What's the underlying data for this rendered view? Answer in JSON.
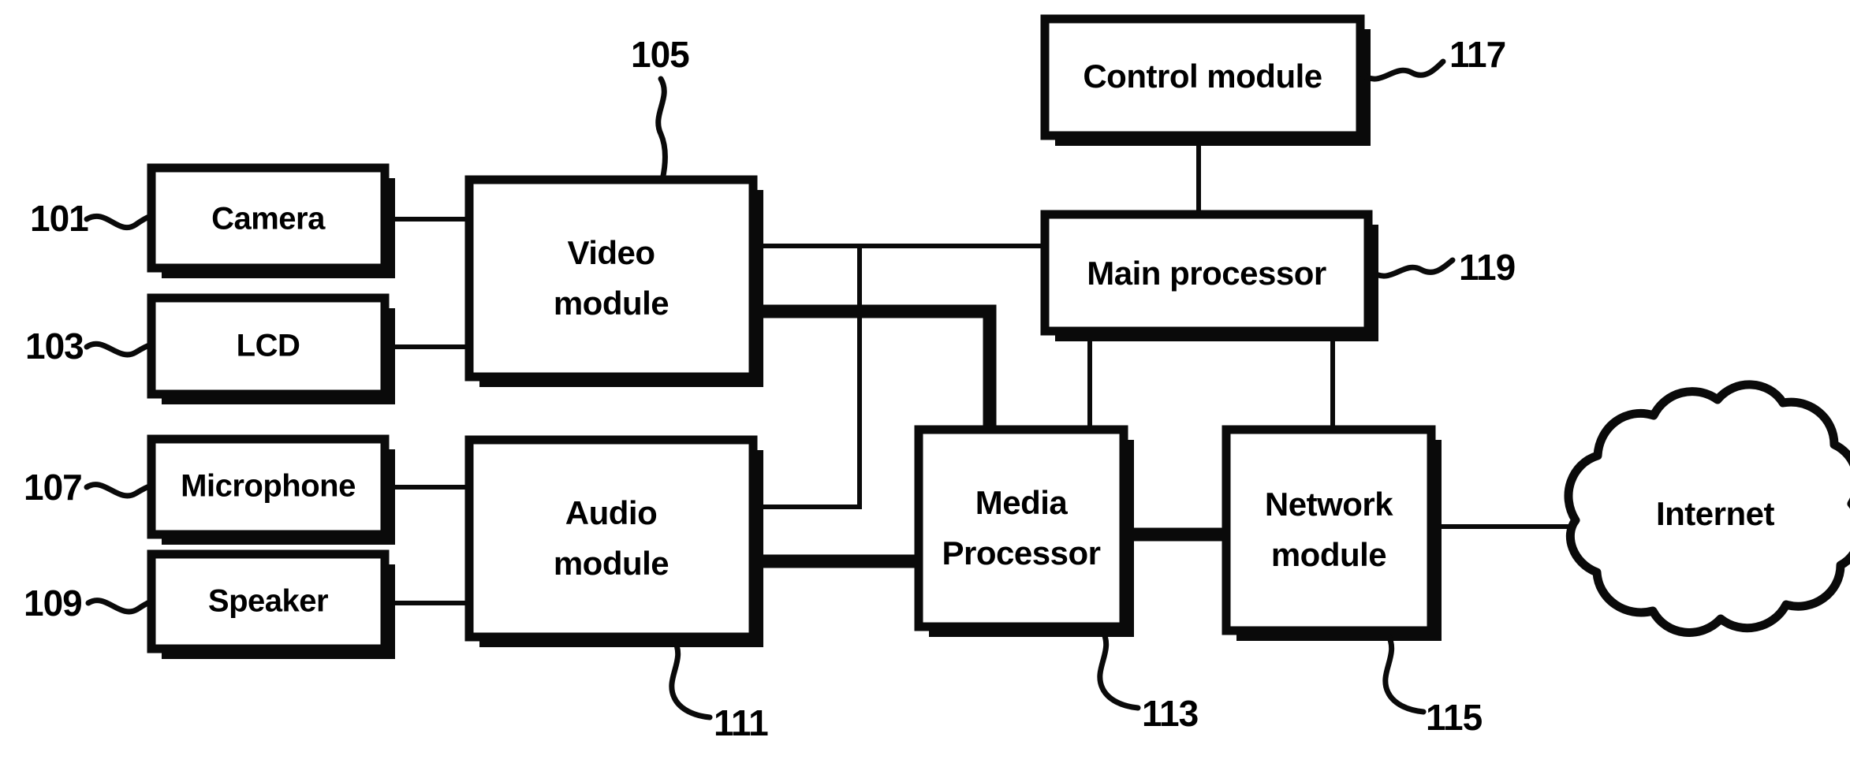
{
  "figure": {
    "type": "block-diagram",
    "style": "patent-drawing",
    "background_color": "#ffffff",
    "line_color": "#000000"
  },
  "blocks": [
    {
      "id": "camera",
      "label": "Camera",
      "ref": "101",
      "lines": [
        "Camera"
      ]
    },
    {
      "id": "lcd",
      "label": "LCD",
      "ref": "103",
      "lines": [
        "LCD"
      ]
    },
    {
      "id": "video_module",
      "label": "Video module",
      "ref": "105",
      "lines": [
        "Video",
        "module"
      ]
    },
    {
      "id": "microphone",
      "label": "Microphone",
      "ref": "107",
      "lines": [
        "Microphone"
      ]
    },
    {
      "id": "speaker",
      "label": "Speaker",
      "ref": "109",
      "lines": [
        "Speaker"
      ]
    },
    {
      "id": "audio_module",
      "label": "Audio module",
      "ref": "111",
      "lines": [
        "Audio",
        "module"
      ]
    },
    {
      "id": "media_processor",
      "label": "Media Processor",
      "ref": "113",
      "lines": [
        "Media",
        "Processor"
      ]
    },
    {
      "id": "network_module",
      "label": "Network module",
      "ref": "115",
      "lines": [
        "Network",
        "module"
      ]
    },
    {
      "id": "control_module",
      "label": "Control module",
      "ref": "117",
      "lines": [
        "Control module"
      ]
    },
    {
      "id": "main_processor",
      "label": "Main processor",
      "ref": "119",
      "lines": [
        "Main processor"
      ]
    },
    {
      "id": "internet",
      "label": "Internet",
      "ref": "",
      "lines": [
        "Internet"
      ]
    }
  ],
  "reference_numerals": {
    "camera": "101",
    "lcd": "103",
    "video_module": "105",
    "microphone": "107",
    "speaker": "109",
    "audio_module": "111",
    "media_processor": "113",
    "network_module": "115",
    "control_module": "117",
    "main_processor": "119"
  },
  "connections": [
    {
      "from": "camera",
      "to": "video_module",
      "weight": "thin"
    },
    {
      "from": "lcd",
      "to": "video_module",
      "weight": "thin"
    },
    {
      "from": "microphone",
      "to": "audio_module",
      "weight": "thin"
    },
    {
      "from": "speaker",
      "to": "audio_module",
      "weight": "thin"
    },
    {
      "from": "video_module",
      "to": "main_processor",
      "weight": "thin"
    },
    {
      "from": "video_module",
      "to": "media_processor",
      "weight": "thick"
    },
    {
      "from": "audio_module",
      "to": "main_processor",
      "weight": "thick"
    },
    {
      "from": "audio_module",
      "to": "media_processor",
      "weight": "thick"
    },
    {
      "from": "control_module",
      "to": "main_processor",
      "weight": "thin"
    },
    {
      "from": "main_processor",
      "to": "media_processor",
      "weight": "thin"
    },
    {
      "from": "main_processor",
      "to": "network_module",
      "weight": "thin"
    },
    {
      "from": "media_processor",
      "to": "network_module",
      "weight": "thick"
    },
    {
      "from": "network_module",
      "to": "internet",
      "weight": "thin"
    }
  ]
}
